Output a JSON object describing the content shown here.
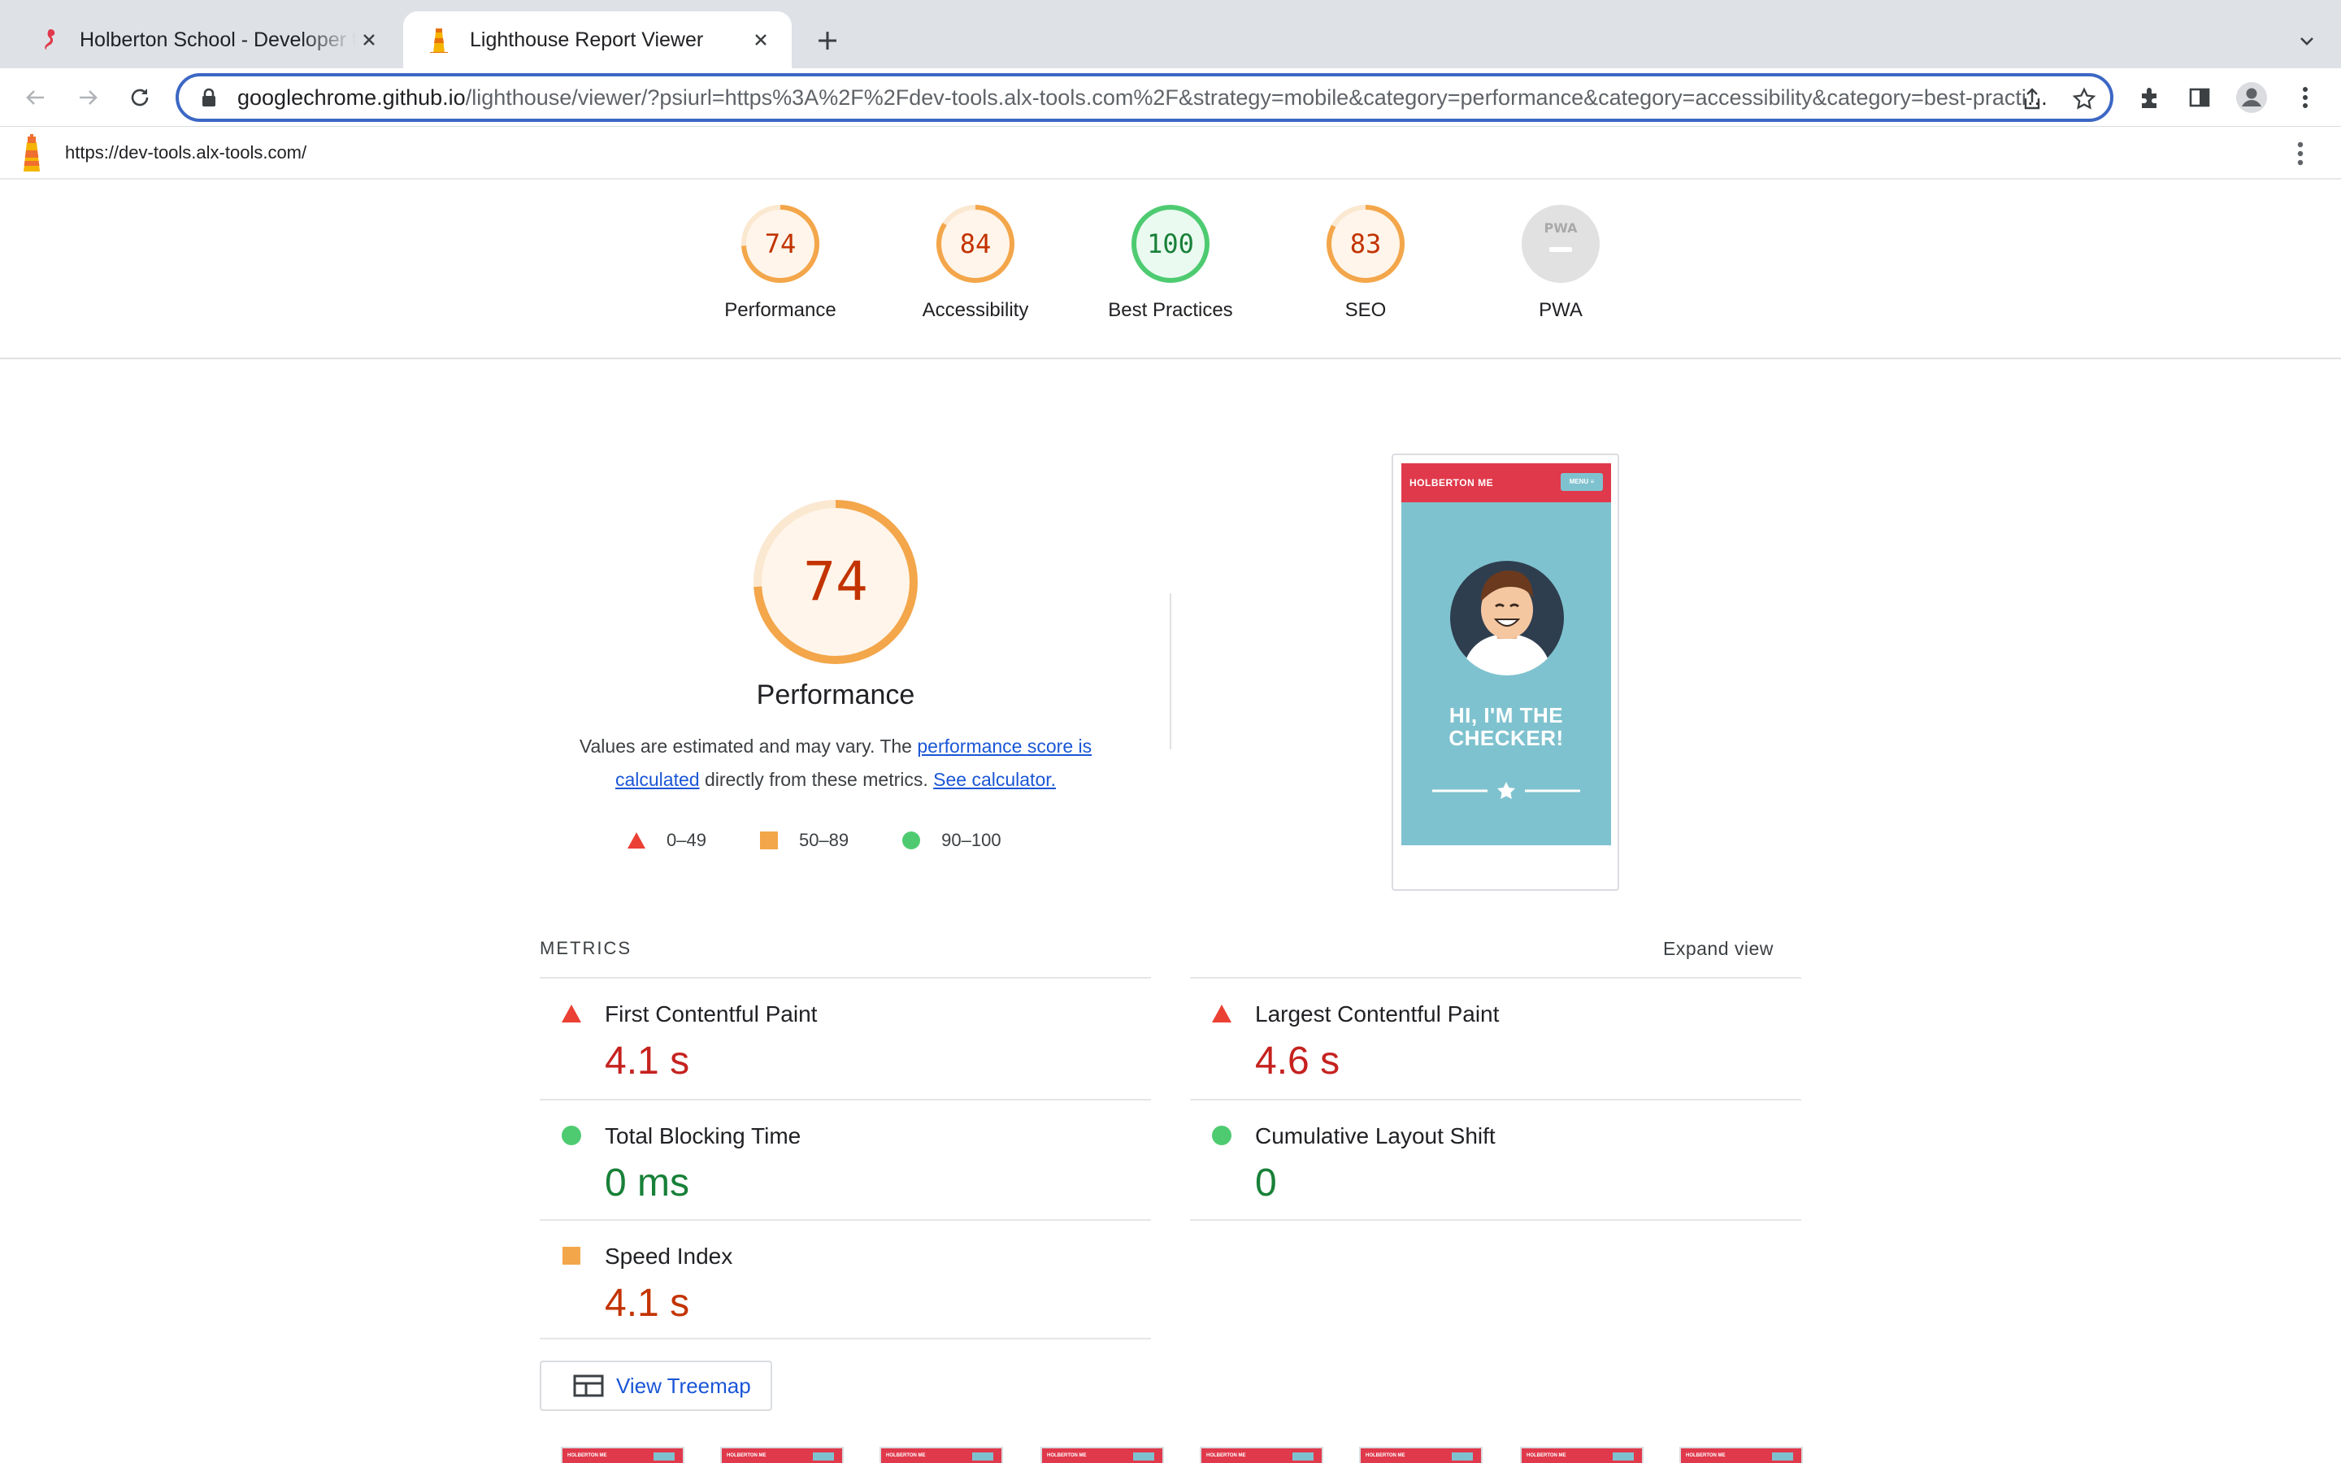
{
  "browser": {
    "tabs": [
      {
        "title": "Holberton School - Developer tools",
        "icon": "seahorse-favicon",
        "active": false
      },
      {
        "title": "Lighthouse Report Viewer",
        "icon": "lighthouse-favicon",
        "active": true
      }
    ],
    "omnibox": {
      "host": "googlechrome.github.io",
      "path": "/lighthouse/viewer/?psiurl=https%3A%2F%2Fdev-tools.alx-tools.com%2F&strategy=mobile&category=performance&category=accessibility&category=best-practices&category=seo&category=pwa"
    },
    "icons": [
      "back-icon",
      "forward-icon",
      "reload-icon",
      "lock-icon",
      "share-icon",
      "star-icon",
      "extensions-icon",
      "side-panel-icon",
      "profile-icon",
      "kebab-menu-icon"
    ]
  },
  "report": {
    "url": "https://dev-tools.alx-tools.com/",
    "categories": [
      {
        "label": "Performance",
        "score": "74",
        "rating": "average"
      },
      {
        "label": "Accessibility",
        "score": "84",
        "rating": "average"
      },
      {
        "label": "Best Practices",
        "score": "100",
        "rating": "pass"
      },
      {
        "label": "SEO",
        "score": "83",
        "rating": "average"
      },
      {
        "label": "PWA",
        "score": "",
        "rating": "na"
      }
    ],
    "pwa_badge_text": "PWA"
  },
  "performance": {
    "score": "74",
    "title": "Performance",
    "desc_prefix": "Values are estimated and may vary. The ",
    "desc_link1": "performance score is calculated",
    "desc_middle": " directly from these metrics. ",
    "desc_link2": "See calculator.",
    "legend": [
      {
        "range": "0–49",
        "icon": "triangle-icon"
      },
      {
        "range": "50–89",
        "icon": "square-icon"
      },
      {
        "range": "90–100",
        "icon": "circle-icon"
      }
    ],
    "screenshot": {
      "brand": "HOLBERTON ME",
      "menu": "MENU ≡",
      "headline_line1": "HI, I'M THE",
      "headline_line2": "CHECKER!"
    }
  },
  "metrics": {
    "header": "METRICS",
    "expand": "Expand view",
    "items": [
      {
        "name": "First Contentful Paint",
        "value": "4.1 s",
        "rating": "fail"
      },
      {
        "name": "Largest Contentful Paint",
        "value": "4.6 s",
        "rating": "fail"
      },
      {
        "name": "Total Blocking Time",
        "value": "0 ms",
        "rating": "pass"
      },
      {
        "name": "Cumulative Layout Shift",
        "value": "0",
        "rating": "pass"
      },
      {
        "name": "Speed Index",
        "value": "4.1 s",
        "rating": "average"
      }
    ],
    "treemap_label": "View Treemap"
  },
  "filmstrip": {
    "frame_count": 8,
    "frame_brand": "HOLBERTON ME"
  },
  "colors": {
    "fail": "#c5221f",
    "average": "#c33300",
    "pass": "#188038",
    "avg_ring": "#f3a64a",
    "pass_ring": "#4ecb71",
    "avg_fill": "#fff5ea",
    "pass_fill": "#eafaf0",
    "link": "#1a56d6"
  }
}
